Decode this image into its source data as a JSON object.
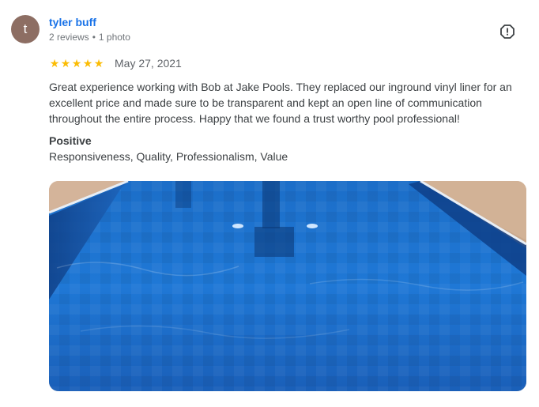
{
  "reviewer": {
    "initial": "t",
    "name": "tyler buff",
    "reviews": "2 reviews",
    "separator": "•",
    "photos": "1 photo",
    "avatar_color": "#8d6e63"
  },
  "review": {
    "rating": 5,
    "stars": [
      "★",
      "★",
      "★",
      "★",
      "★"
    ],
    "star_color": "#fbbc04",
    "date": "May 27, 2021",
    "text": "Great experience working with Bob at Jake Pools. They replaced our inground vinyl liner for an excellent price and made sure to be transparent and kept an open line of communication throughout the entire process. Happy that we found a trust worthy pool professional!",
    "attributes_title": "Positive",
    "attributes": "Responsiveness, Quality, Professionalism, Value"
  },
  "icons": {
    "report": "flag-report-icon"
  },
  "photo": {
    "subject": "swimming pool with blue vinyl liner",
    "water_color": "#1f6fc4"
  }
}
